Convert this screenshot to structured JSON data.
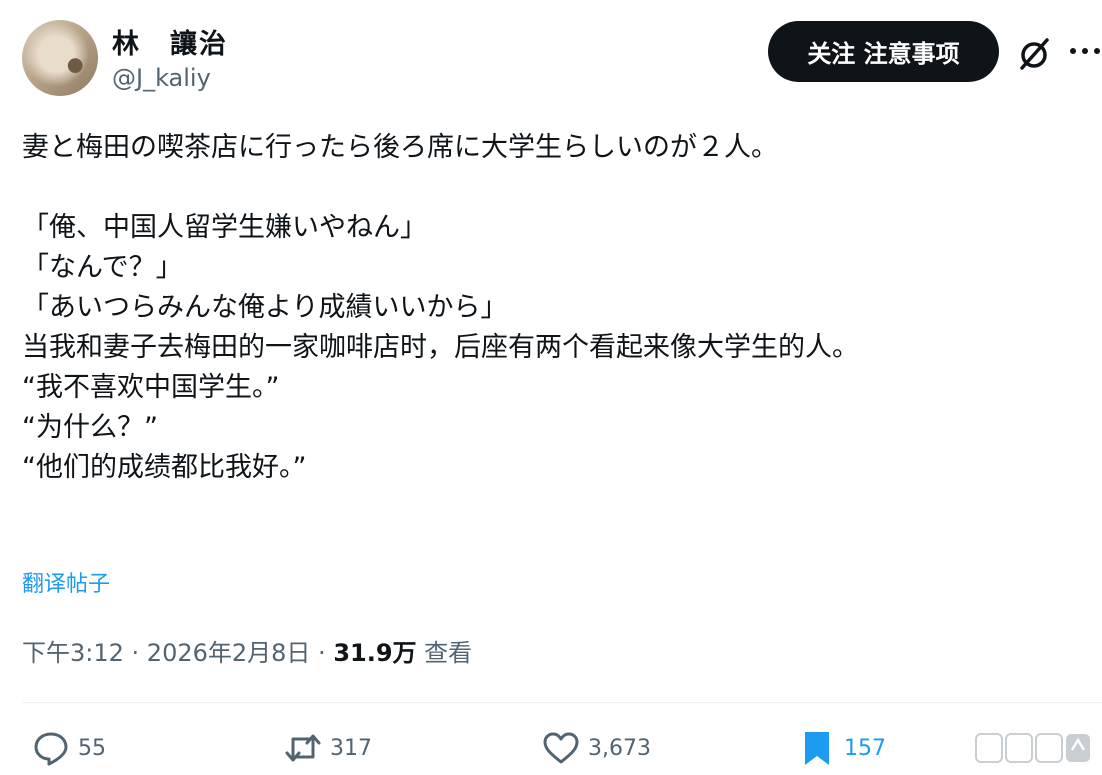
{
  "author": {
    "display_name": "林　讓治",
    "handle": "@J_kaliy"
  },
  "follow_button_label": "关注 注意事项",
  "tweet": {
    "lines": [
      "妻と梅田の喫茶店に行ったら後ろ席に大学生らしいのが２人。",
      "",
      "「俺、中国人留学生嫌いやねん」",
      "「なんで？」",
      "「あいつらみんな俺より成績いいから」",
      "当我和妻子去梅田的一家咖啡店时，后座有两个看起来像大学生的人。",
      "“我不喜欢中国学生。”",
      "“为什么？”",
      "“他们的成绩都比我好。”"
    ]
  },
  "translate_label": "翻译帖子",
  "meta": {
    "time": "下午3:12",
    "separator": " · ",
    "date": "2026年2月8日",
    "views_count": "31.9万",
    "views_label": " 查看"
  },
  "actions": {
    "replies": "55",
    "reposts": "317",
    "likes": "3,673",
    "bookmarks": "157"
  },
  "colors": {
    "accent": "#1d9bf0",
    "text": "#0f1419",
    "secondary": "#536471"
  },
  "icons": [
    "grok-icon",
    "more-icon",
    "reply-icon",
    "repost-icon",
    "like-icon",
    "bookmark-icon",
    "share-icon"
  ]
}
